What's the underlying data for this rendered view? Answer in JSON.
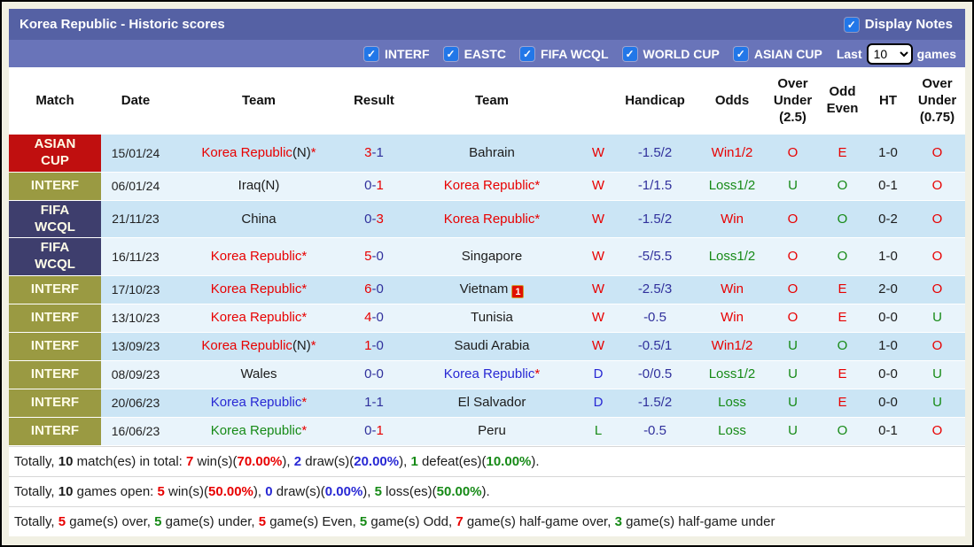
{
  "palette": {
    "red": "#e80000",
    "navy": "#30309c",
    "blue": "#2828d4",
    "green": "#168a16",
    "black": "#1c1c1c"
  },
  "header": {
    "title": "Korea Republic - Historic scores",
    "display_notes": {
      "label": "Display Notes",
      "checked": true,
      "check_glyph": "✓"
    }
  },
  "filter_bar": {
    "checkboxes": [
      {
        "label": "INTERF",
        "checked": true
      },
      {
        "label": "EASTC",
        "checked": true
      },
      {
        "label": "FIFA WCQL",
        "checked": true
      },
      {
        "label": "WORLD CUP",
        "checked": true
      },
      {
        "label": "ASIAN CUP",
        "checked": true
      }
    ],
    "last_label": "Last",
    "games_label": "games",
    "select_value": "10",
    "check_glyph": "✓"
  },
  "table": {
    "columns": [
      "Match",
      "Date",
      "Team",
      "Result",
      "Team",
      "",
      "Handicap",
      "Odds",
      "Over Under (2.5)",
      "Odd Even",
      "HT",
      "Over Under (0.75)"
    ],
    "competition_colors": {
      "ASIAN\nCUP": "#c00f0f",
      "INTERF": "#9a9a42",
      "FIFA\nWCQL": "#3e3e6d"
    },
    "rows": [
      {
        "competition": "ASIAN\nCUP",
        "date": "15/01/24",
        "home": [
          [
            "Korea Republic",
            "red"
          ],
          [
            "(N)",
            "black"
          ],
          [
            "*",
            "red"
          ]
        ],
        "result": [
          [
            "3",
            "red"
          ],
          [
            "-",
            "navy"
          ],
          [
            "1",
            "navy"
          ]
        ],
        "away": [
          [
            "Bahrain",
            "black"
          ]
        ],
        "away_badge": null,
        "wdl": [
          "W",
          "red"
        ],
        "handicap": "-1.5/2",
        "odds": [
          "Win1/2",
          "red"
        ],
        "ou25": [
          "O",
          "red"
        ],
        "oddeven": [
          "E",
          "red"
        ],
        "ht": "1-0",
        "ou075": [
          "O",
          "red"
        ]
      },
      {
        "competition": "INTERF",
        "date": "06/01/24",
        "home": [
          [
            "Iraq(N)",
            "black"
          ]
        ],
        "result": [
          [
            "0",
            "navy"
          ],
          [
            "-",
            "navy"
          ],
          [
            "1",
            "red"
          ]
        ],
        "away": [
          [
            "Korea Republic",
            "red"
          ],
          [
            "*",
            "red"
          ]
        ],
        "away_badge": null,
        "wdl": [
          "W",
          "red"
        ],
        "handicap": "-1/1.5",
        "odds": [
          "Loss1/2",
          "green"
        ],
        "ou25": [
          "U",
          "green"
        ],
        "oddeven": [
          "O",
          "green"
        ],
        "ht": "0-1",
        "ou075": [
          "O",
          "red"
        ]
      },
      {
        "competition": "FIFA\nWCQL",
        "date": "21/11/23",
        "home": [
          [
            "China",
            "black"
          ]
        ],
        "result": [
          [
            "0",
            "navy"
          ],
          [
            "-",
            "navy"
          ],
          [
            "3",
            "red"
          ]
        ],
        "away": [
          [
            "Korea Republic",
            "red"
          ],
          [
            "*",
            "red"
          ]
        ],
        "away_badge": null,
        "wdl": [
          "W",
          "red"
        ],
        "handicap": "-1.5/2",
        "odds": [
          "Win",
          "red"
        ],
        "ou25": [
          "O",
          "red"
        ],
        "oddeven": [
          "O",
          "green"
        ],
        "ht": "0-2",
        "ou075": [
          "O",
          "red"
        ]
      },
      {
        "competition": "FIFA\nWCQL",
        "date": "16/11/23",
        "home": [
          [
            "Korea Republic",
            "red"
          ],
          [
            "*",
            "red"
          ]
        ],
        "result": [
          [
            "5",
            "red"
          ],
          [
            "-",
            "navy"
          ],
          [
            "0",
            "navy"
          ]
        ],
        "away": [
          [
            "Singapore",
            "black"
          ]
        ],
        "away_badge": null,
        "wdl": [
          "W",
          "red"
        ],
        "handicap": "-5/5.5",
        "odds": [
          "Loss1/2",
          "green"
        ],
        "ou25": [
          "O",
          "red"
        ],
        "oddeven": [
          "O",
          "green"
        ],
        "ht": "1-0",
        "ou075": [
          "O",
          "red"
        ]
      },
      {
        "competition": "INTERF",
        "date": "17/10/23",
        "home": [
          [
            "Korea Republic",
            "red"
          ],
          [
            "*",
            "red"
          ]
        ],
        "result": [
          [
            "6",
            "red"
          ],
          [
            "-",
            "navy"
          ],
          [
            "0",
            "navy"
          ]
        ],
        "away": [
          [
            "Vietnam",
            "black"
          ]
        ],
        "away_badge": {
          "icon": "red-card",
          "text": "1"
        },
        "wdl": [
          "W",
          "red"
        ],
        "handicap": "-2.5/3",
        "odds": [
          "Win",
          "red"
        ],
        "ou25": [
          "O",
          "red"
        ],
        "oddeven": [
          "E",
          "red"
        ],
        "ht": "2-0",
        "ou075": [
          "O",
          "red"
        ]
      },
      {
        "competition": "INTERF",
        "date": "13/10/23",
        "home": [
          [
            "Korea Republic",
            "red"
          ],
          [
            "*",
            "red"
          ]
        ],
        "result": [
          [
            "4",
            "red"
          ],
          [
            "-",
            "navy"
          ],
          [
            "0",
            "navy"
          ]
        ],
        "away": [
          [
            "Tunisia",
            "black"
          ]
        ],
        "away_badge": null,
        "wdl": [
          "W",
          "red"
        ],
        "handicap": "-0.5",
        "odds": [
          "Win",
          "red"
        ],
        "ou25": [
          "O",
          "red"
        ],
        "oddeven": [
          "E",
          "red"
        ],
        "ht": "0-0",
        "ou075": [
          "U",
          "green"
        ]
      },
      {
        "competition": "INTERF",
        "date": "13/09/23",
        "home": [
          [
            "Korea Republic",
            "red"
          ],
          [
            "(N)",
            "black"
          ],
          [
            "*",
            "red"
          ]
        ],
        "result": [
          [
            "1",
            "red"
          ],
          [
            "-",
            "navy"
          ],
          [
            "0",
            "navy"
          ]
        ],
        "away": [
          [
            "Saudi Arabia",
            "black"
          ]
        ],
        "away_badge": null,
        "wdl": [
          "W",
          "red"
        ],
        "handicap": "-0.5/1",
        "odds": [
          "Win1/2",
          "red"
        ],
        "ou25": [
          "U",
          "green"
        ],
        "oddeven": [
          "O",
          "green"
        ],
        "ht": "1-0",
        "ou075": [
          "O",
          "red"
        ]
      },
      {
        "competition": "INTERF",
        "date": "08/09/23",
        "home": [
          [
            "Wales",
            "black"
          ]
        ],
        "result": [
          [
            "0",
            "navy"
          ],
          [
            "-",
            "navy"
          ],
          [
            "0",
            "navy"
          ]
        ],
        "away": [
          [
            "Korea Republic",
            "blue"
          ],
          [
            "*",
            "red"
          ]
        ],
        "away_badge": null,
        "wdl": [
          "D",
          "blue"
        ],
        "handicap": "-0/0.5",
        "odds": [
          "Loss1/2",
          "green"
        ],
        "ou25": [
          "U",
          "green"
        ],
        "oddeven": [
          "E",
          "red"
        ],
        "ht": "0-0",
        "ou075": [
          "U",
          "green"
        ]
      },
      {
        "competition": "INTERF",
        "date": "20/06/23",
        "home": [
          [
            "Korea Republic",
            "blue"
          ],
          [
            "*",
            "red"
          ]
        ],
        "result": [
          [
            "1",
            "navy"
          ],
          [
            "-",
            "navy"
          ],
          [
            "1",
            "navy"
          ]
        ],
        "away": [
          [
            "El Salvador",
            "black"
          ]
        ],
        "away_badge": null,
        "wdl": [
          "D",
          "blue"
        ],
        "handicap": "-1.5/2",
        "odds": [
          "Loss",
          "green"
        ],
        "ou25": [
          "U",
          "green"
        ],
        "oddeven": [
          "E",
          "red"
        ],
        "ht": "0-0",
        "ou075": [
          "U",
          "green"
        ]
      },
      {
        "competition": "INTERF",
        "date": "16/06/23",
        "home": [
          [
            "Korea Republic",
            "green"
          ],
          [
            "*",
            "red"
          ]
        ],
        "result": [
          [
            "0",
            "navy"
          ],
          [
            "-",
            "navy"
          ],
          [
            "1",
            "red"
          ]
        ],
        "away": [
          [
            "Peru",
            "black"
          ]
        ],
        "away_badge": null,
        "wdl": [
          "L",
          "green"
        ],
        "handicap": "-0.5",
        "odds": [
          "Loss",
          "green"
        ],
        "ou25": [
          "U",
          "green"
        ],
        "oddeven": [
          "O",
          "green"
        ],
        "ht": "0-1",
        "ou075": [
          "O",
          "red"
        ]
      }
    ]
  },
  "summary_lines": [
    [
      [
        "Totally, ",
        "black",
        0
      ],
      [
        "10",
        "black",
        1
      ],
      [
        " match(es) in total: ",
        "black",
        0
      ],
      [
        "7",
        "red",
        1
      ],
      [
        " win(s)(",
        "black",
        0
      ],
      [
        "70.00%",
        "red",
        1
      ],
      [
        "), ",
        "black",
        0
      ],
      [
        "2",
        "blue",
        1
      ],
      [
        " draw(s)(",
        "black",
        0
      ],
      [
        "20.00%",
        "blue",
        1
      ],
      [
        "), ",
        "black",
        0
      ],
      [
        "1",
        "green",
        1
      ],
      [
        " defeat(es)(",
        "black",
        0
      ],
      [
        "10.00%",
        "green",
        1
      ],
      [
        ").",
        "black",
        0
      ]
    ],
    [
      [
        "Totally, ",
        "black",
        0
      ],
      [
        "10",
        "black",
        1
      ],
      [
        " games open: ",
        "black",
        0
      ],
      [
        "5",
        "red",
        1
      ],
      [
        " win(s)(",
        "black",
        0
      ],
      [
        "50.00%",
        "red",
        1
      ],
      [
        "), ",
        "black",
        0
      ],
      [
        "0",
        "blue",
        1
      ],
      [
        " draw(s)(",
        "black",
        0
      ],
      [
        "0.00%",
        "blue",
        1
      ],
      [
        "), ",
        "black",
        0
      ],
      [
        "5",
        "green",
        1
      ],
      [
        " loss(es)(",
        "black",
        0
      ],
      [
        "50.00%",
        "green",
        1
      ],
      [
        ").",
        "black",
        0
      ]
    ],
    [
      [
        "Totally, ",
        "black",
        0
      ],
      [
        "5",
        "red",
        1
      ],
      [
        " game(s) over, ",
        "black",
        0
      ],
      [
        "5",
        "green",
        1
      ],
      [
        " game(s) under, ",
        "black",
        0
      ],
      [
        "5",
        "red",
        1
      ],
      [
        " game(s) Even, ",
        "black",
        0
      ],
      [
        "5",
        "green",
        1
      ],
      [
        " game(s) Odd, ",
        "black",
        0
      ],
      [
        "7",
        "red",
        1
      ],
      [
        " game(s) half-game over, ",
        "black",
        0
      ],
      [
        "3",
        "green",
        1
      ],
      [
        " game(s) half-game under",
        "black",
        0
      ]
    ]
  ]
}
